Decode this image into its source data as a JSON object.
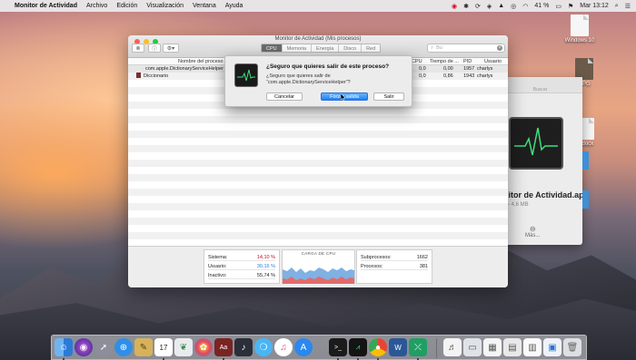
{
  "menubar": {
    "app_name": "Monitor de Actividad",
    "items": [
      "Archivo",
      "Edición",
      "Visualización",
      "Ventana",
      "Ayuda"
    ],
    "battery": "41 %",
    "clock": "Mar 13:12"
  },
  "desktop": {
    "icons": [
      "Windows 10",
      ".JPG",
      "A.docx"
    ]
  },
  "background_window": {
    "title": "Buscar",
    "app_title": "nitor de Actividad.app",
    "subtitle": "n - 4,6 MB",
    "more": "Más..."
  },
  "window": {
    "title": "Monitor de Actividad (Mis procesos)",
    "tabs": [
      {
        "label": "CPU",
        "active": true
      },
      {
        "label": "Memoria",
        "active": false
      },
      {
        "label": "Energía",
        "active": false
      },
      {
        "label": "Disco",
        "active": false
      },
      {
        "label": "Red",
        "active": false
      }
    ],
    "search_placeholder": "Bu",
    "columns": {
      "name": "Nombre del proceso",
      "cpu": "CPU",
      "time": "Tiempo de ...",
      "pid": "PID",
      "user": "Usuario"
    },
    "rows": [
      {
        "name": "com.apple.DictionaryServiceHelper",
        "cpu": "0,0",
        "time": "0,00",
        "pid": "1957",
        "user": "charlys",
        "selected": true
      },
      {
        "name": "Diccionario",
        "cpu": "0,0",
        "time": "0,86",
        "pid": "1943",
        "user": "charlys",
        "selected": false
      }
    ],
    "footer": {
      "left": [
        {
          "label": "Sistema:",
          "value": "14,10 %",
          "color": "#d0021b"
        },
        {
          "label": "Usuario:",
          "value": "30,16 %",
          "color": "#1f7fd8"
        },
        {
          "label": "Inactivo:",
          "value": "55,74 %",
          "color": "#222222"
        }
      ],
      "graph_title": "CARGA DE CPU",
      "right": [
        {
          "label": "Subprocesos:",
          "value": "1662"
        },
        {
          "label": "Procesos:",
          "value": "381"
        }
      ]
    }
  },
  "dialog": {
    "title": "¿Seguro que quieres salir de este proceso?",
    "message": "¿Seguro que quieres salir de “com.apple.DictionaryServiceHelper”?",
    "cancel": "Cancelar",
    "force_quit": "Forzar salida",
    "quit": "Salir"
  },
  "dock": {
    "apps": [
      "finder-icon",
      "siri-icon",
      "launchpad-icon",
      "safari-icon",
      "notes-icon",
      "calendar-icon",
      "photos-icon",
      "itunes-icon",
      "dictionary-icon",
      "messages-icon",
      "music-icon",
      "appstore-icon",
      "terminal-icon",
      "activity-monitor-icon",
      "chrome-icon",
      "word-icon",
      "app-icon"
    ],
    "calendar_day": "17"
  }
}
